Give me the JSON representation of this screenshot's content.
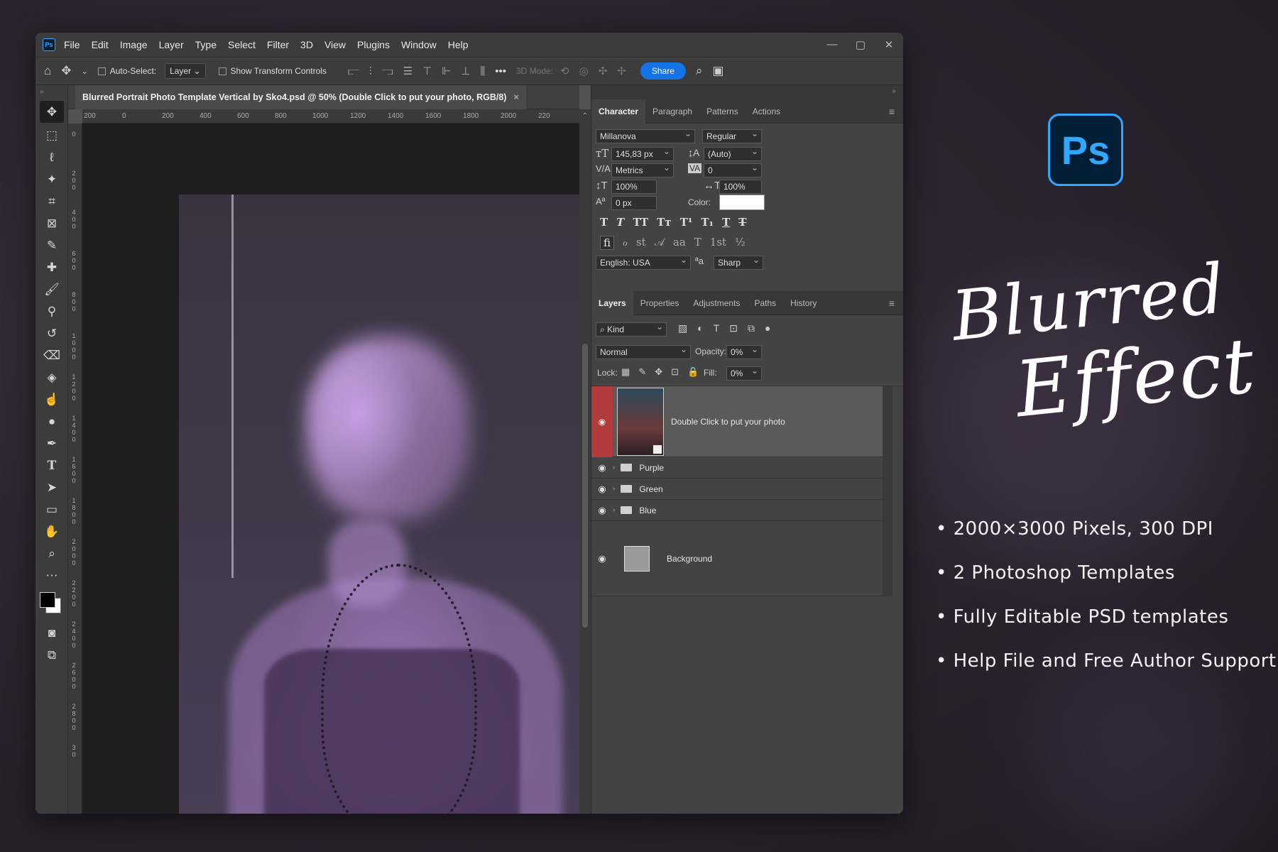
{
  "app": {
    "logo_text": "Ps"
  },
  "menu": [
    "File",
    "Edit",
    "Image",
    "Layer",
    "Type",
    "Select",
    "Filter",
    "3D",
    "View",
    "Plugins",
    "Window",
    "Help"
  ],
  "window_controls": [
    "—",
    "▢",
    "✕"
  ],
  "options_bar": {
    "auto_select_label": "Auto-Select:",
    "auto_select_value": "Layer",
    "transform_label": "Show Transform Controls",
    "more": "•••",
    "mode_3d": "3D Mode:",
    "share": "Share"
  },
  "document": {
    "tab_title": "Blurred Portrait Photo Template Vertical by Sko4.psd @ 50% (Double Click to put your photo, RGB/8)",
    "close": "×",
    "ruler_h": [
      "200",
      "0",
      "200",
      "400",
      "600",
      "800",
      "1000",
      "1200",
      "1400",
      "1600",
      "1800",
      "2000",
      "220"
    ],
    "ruler_v": [
      "0",
      "0",
      "2 0 0",
      "4 0 0",
      "6 0 0",
      "8 0 0",
      "1 0 0 0",
      "1 2 0 0",
      "1 4 0 0",
      "1 6 0 0",
      "1 8 0 0",
      "2 0 0 0",
      "2 2 0 0",
      "2 4 0 0",
      "2 6 0 0",
      "2 8 0 0",
      "3 0"
    ]
  },
  "character_panel": {
    "tabs": [
      "Character",
      "Paragraph",
      "Patterns",
      "Actions"
    ],
    "font_family": "Millanova",
    "font_style": "Regular",
    "font_size": "145,83 px",
    "leading": "(Auto)",
    "kerning": "Metrics",
    "tracking": "0",
    "vertical_scale": "100%",
    "horizontal_scale": "100%",
    "baseline_shift": "0 px",
    "color_label": "Color:",
    "color_value": "#ffffff",
    "language": "English: USA",
    "antialias": "Sharp",
    "glyphs_row1": [
      "T",
      "T",
      "TT",
      "Tт",
      "T¹",
      "T₁",
      "T",
      "T"
    ],
    "glyphs_row2": [
      "ﬁ",
      "ℴ",
      "st",
      "𝒜",
      "aa",
      "T",
      "1st",
      "½"
    ]
  },
  "layers_panel": {
    "tabs": [
      "Layers",
      "Properties",
      "Adjustments",
      "Paths",
      "History"
    ],
    "filter_kind": "Kind",
    "blend_mode": "Normal",
    "opacity_label": "Opacity:",
    "opacity_value": "0%",
    "lock_label": "Lock:",
    "fill_label": "Fill:",
    "fill_value": "0%",
    "layers": [
      {
        "name": "Double Click to put your photo",
        "type": "smart-object",
        "selected": true
      },
      {
        "name": "Purple",
        "type": "group"
      },
      {
        "name": "Green",
        "type": "group"
      },
      {
        "name": "Blue",
        "type": "group"
      },
      {
        "name": "Background",
        "type": "background"
      }
    ]
  },
  "promo": {
    "logo": "Ps",
    "title_line1": "Blurred",
    "title_line2": "Effect",
    "features": [
      "2000×3000 Pixels, 300 DPI",
      "2 Photoshop Templates",
      "Fully Editable PSD templates",
      "Help File and Free Author Support"
    ]
  },
  "colors": {
    "accent": "#1473e6",
    "ps_blue": "#31a8ff",
    "ps_dark": "#001e36",
    "selected_layer_marker": "#c04040",
    "photo_tint": "#b894d8"
  }
}
